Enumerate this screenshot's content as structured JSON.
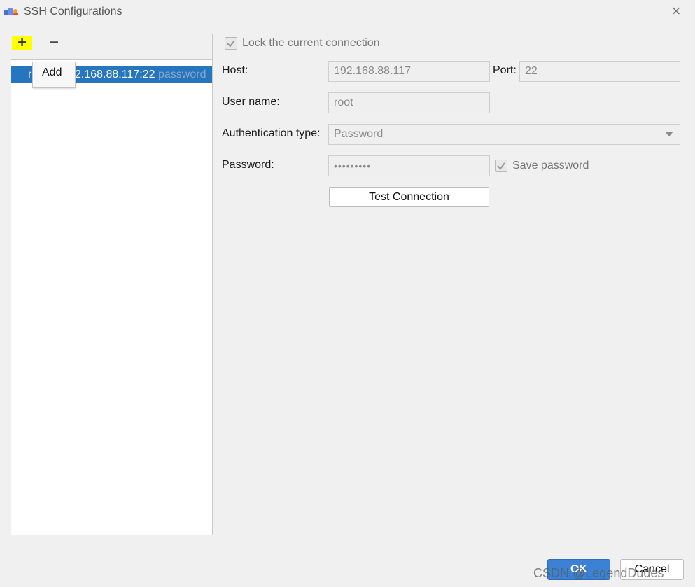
{
  "window": {
    "title": "SSH Configurations",
    "close_icon": "close-icon",
    "close_glyph": "×"
  },
  "toolbar": {
    "add_glyph": "+",
    "remove_glyph": "−",
    "add_tooltip": "Add",
    "highlight_color": "#ffff00"
  },
  "config_list": {
    "selected_item": {
      "prefix": "r",
      "host": "2.168.88.117:22",
      "auth": "password"
    },
    "selection_color": "#2675bf"
  },
  "form": {
    "lock_label": "Lock the current connection",
    "lock_checked": true,
    "host_label": "Host:",
    "host_value": "192.168.88.117",
    "port_label": "Port:",
    "port_value": "22",
    "user_label": "User name:",
    "user_value": "root",
    "auth_label": "Authentication type:",
    "auth_value": "Password",
    "password_label": "Password:",
    "password_value": "•••••••••",
    "save_password_label": "Save password",
    "save_password_checked": true,
    "test_button_label": "Test Connection"
  },
  "footer": {
    "ok_label": "OK",
    "cancel_label": "Cancel",
    "ok_color": "#3b82d6"
  },
  "watermark": "CSDN @LegendDudes"
}
